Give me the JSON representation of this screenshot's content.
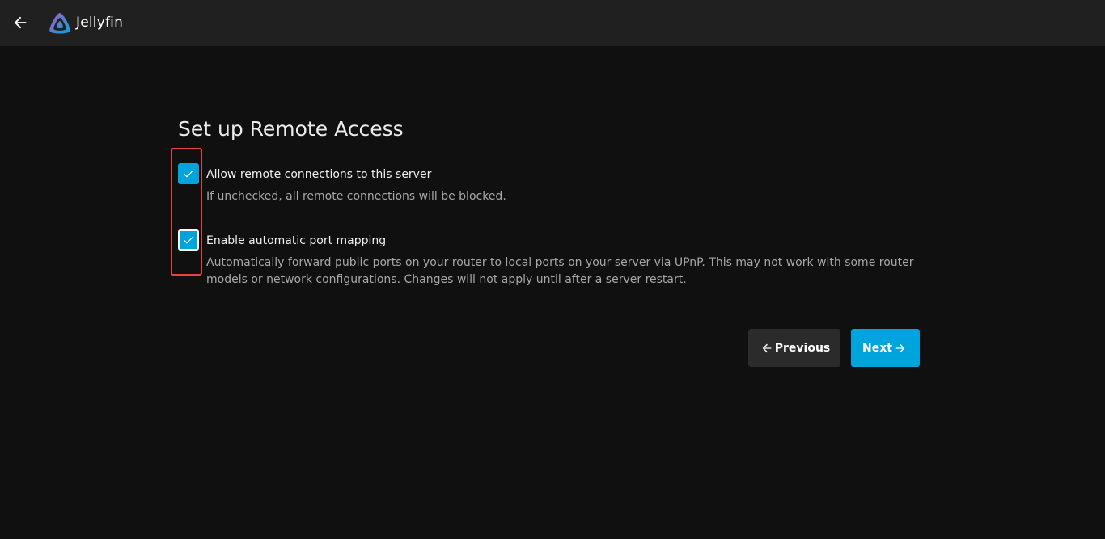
{
  "header": {
    "brand": "Jellyfin",
    "back_icon": "arrow-left-icon",
    "logo_icon": "jellyfin-logo-icon"
  },
  "page": {
    "title": "Set up Remote Access"
  },
  "options": [
    {
      "label": "Allow remote connections to this server",
      "description": "If unchecked, all remote connections will be blocked.",
      "checked": true
    },
    {
      "label": "Enable automatic port mapping",
      "description": "Automatically forward public ports on your router to local ports on your server via UPnP. This may not work with some router models or network configurations. Changes will not apply until after a server restart.",
      "checked": true
    }
  ],
  "buttons": {
    "previous": "Previous",
    "next": "Next"
  },
  "colors": {
    "accent": "#00a4dc",
    "highlight": "#e04545",
    "background": "#101010",
    "header": "#202020"
  }
}
